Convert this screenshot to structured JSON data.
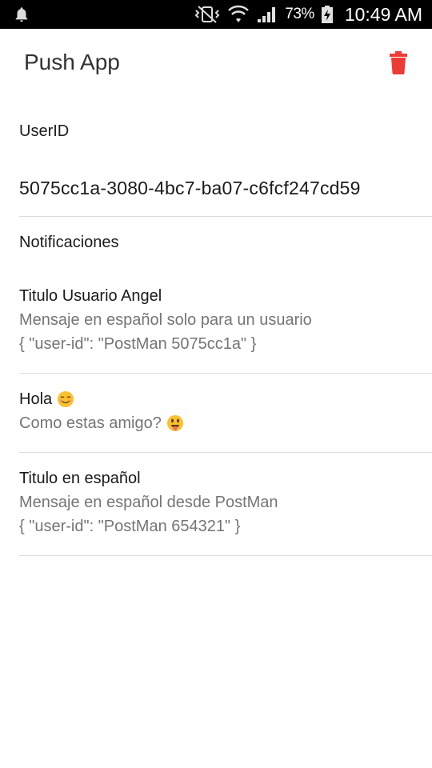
{
  "status_bar": {
    "battery_percent": "73%",
    "time": "10:49 AM"
  },
  "app_bar": {
    "title": "Push App",
    "delete_icon": "trash-icon",
    "accent": "#ef3b36"
  },
  "user": {
    "label": "UserID",
    "id": "5075cc1a-3080-4bc7-ba07-c6fcf247cd59"
  },
  "notifications": {
    "label": "Notificaciones",
    "items": [
      {
        "title": "Titulo Usuario Angel",
        "body": "Mensaje en español solo para un usuario",
        "data": "{ \"user-id\": \"PostMan 5075cc1a\" }"
      },
      {
        "title": "Hola",
        "title_emoji": "smiling-face-emoji",
        "body": "Como estas amigo?",
        "body_emoji": "face-with-tongue-emoji"
      },
      {
        "title": "Titulo en español",
        "body": "Mensaje en español desde PostMan",
        "data": "{ \"user-id\": \"PostMan 654321\" }"
      }
    ]
  }
}
